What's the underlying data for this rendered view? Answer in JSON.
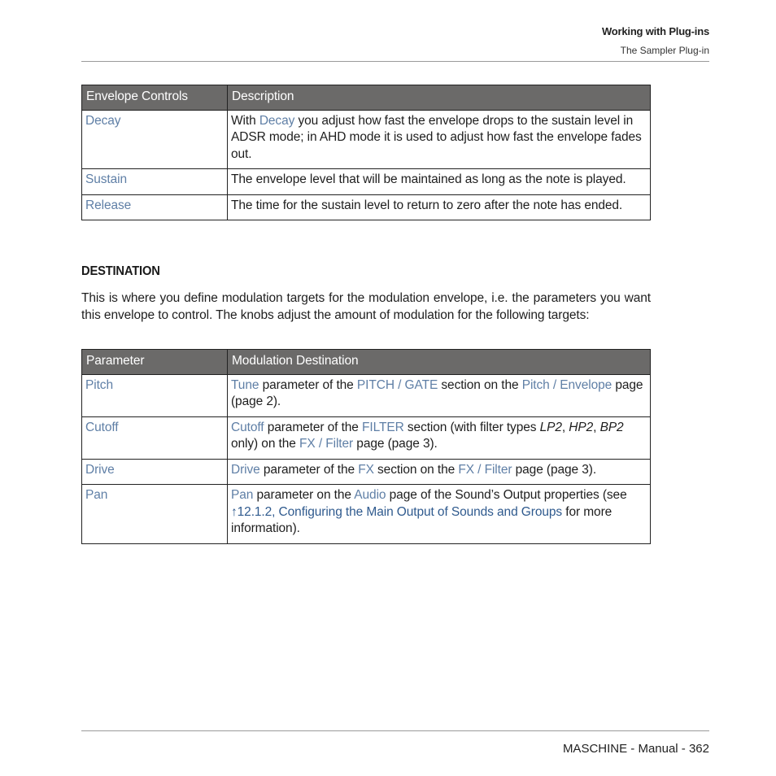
{
  "header": {
    "chapter": "Working with Plug-ins",
    "section": "The Sampler Plug-in"
  },
  "envelope_table": {
    "headers": [
      "Envelope Controls",
      "Description"
    ],
    "rows": [
      {
        "control": "Decay",
        "desc": [
          {
            "t": "With "
          },
          {
            "t": "Decay",
            "link": true
          },
          {
            "t": " you adjust how fast the envelope drops to the sustain level in ADSR mode; in AHD mode it is used to adjust how fast the envelope fades out."
          }
        ]
      },
      {
        "control": "Sustain",
        "desc": [
          {
            "t": "The envelope level that will be maintained as long as the note is played."
          }
        ]
      },
      {
        "control": "Release",
        "desc": [
          {
            "t": "The time for the sustain level to return to zero after the note has ended."
          }
        ]
      }
    ]
  },
  "destination": {
    "heading": "DESTINATION",
    "paragraph": "This is where you define modulation targets for the modulation envelope, i.e. the parameters you want this envelope to control. The knobs adjust the amount of modulation for the following targets:"
  },
  "modulation_table": {
    "headers": [
      "Parameter",
      "Modulation Destination"
    ],
    "rows": [
      {
        "param": "Pitch",
        "desc": [
          {
            "t": "Tune",
            "link": true
          },
          {
            "t": " parameter of the "
          },
          {
            "t": "PITCH / GATE",
            "link": true
          },
          {
            "t": " section on the "
          },
          {
            "t": "Pitch / Envelope",
            "link": true
          },
          {
            "t": " page (page 2)."
          }
        ]
      },
      {
        "param": "Cutoff",
        "desc": [
          {
            "t": "Cutoff",
            "link": true
          },
          {
            "t": " parameter of the "
          },
          {
            "t": "FILTER",
            "link": true
          },
          {
            "t": " section (with filter types "
          },
          {
            "t": "LP2",
            "italic": true
          },
          {
            "t": ", "
          },
          {
            "t": "HP2",
            "italic": true
          },
          {
            "t": ", "
          },
          {
            "t": "BP2",
            "italic": true
          },
          {
            "t": " only) on the "
          },
          {
            "t": "FX / Filter",
            "link": true
          },
          {
            "t": " page (page 3)."
          }
        ]
      },
      {
        "param": "Drive",
        "desc": [
          {
            "t": "Drive",
            "link": true
          },
          {
            "t": " parameter of the "
          },
          {
            "t": "FX",
            "link": true
          },
          {
            "t": " section on the "
          },
          {
            "t": "FX / Filter",
            "link": true
          },
          {
            "t": " page (page 3)."
          }
        ]
      },
      {
        "param": "Pan",
        "desc": [
          {
            "t": "Pan",
            "link": true
          },
          {
            "t": " parameter on the "
          },
          {
            "t": "Audio",
            "link": true
          },
          {
            "t": " page of the Sound’s Output properties (see "
          },
          {
            "t": "↑12.1.2, Configuring the Main Output of Sounds and Groups",
            "xref": true
          },
          {
            "t": " for more information)."
          }
        ]
      }
    ]
  },
  "footer": {
    "text": "MASCHINE - Manual - 362"
  },
  "colors": {
    "header_bg": "#6b6a69",
    "link": "#5f7fa6",
    "xref": "#2f5a8e"
  }
}
